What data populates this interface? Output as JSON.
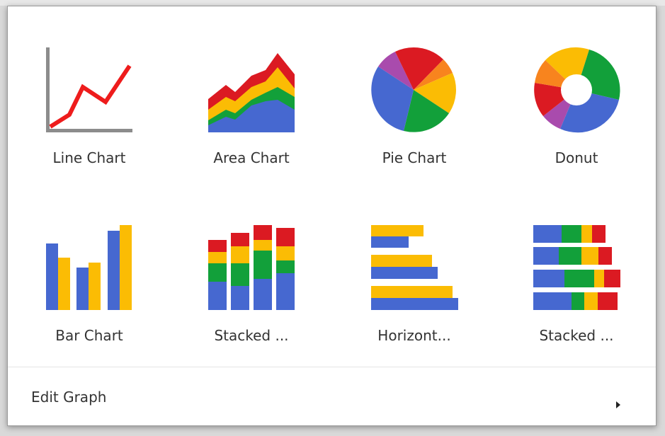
{
  "colors": {
    "blue": "#4668d0",
    "yellow": "#fbbc04",
    "green": "#12a03a",
    "red": "#db1a22",
    "orange": "#f8841e",
    "purple": "#a94bad",
    "axis": "#8c8c8c"
  },
  "chart_menu": {
    "items": [
      {
        "label": "Line Chart",
        "icon": "line-chart-icon"
      },
      {
        "label": "Area Chart",
        "icon": "area-chart-icon"
      },
      {
        "label": "Pie Chart",
        "icon": "pie-chart-icon"
      },
      {
        "label": "Donut",
        "icon": "donut-chart-icon"
      },
      {
        "label": "Bar Chart",
        "icon": "bar-chart-icon"
      },
      {
        "label": "Stacked ...",
        "icon": "stacked-bar-chart-icon"
      },
      {
        "label": "Horizont...",
        "icon": "horizontal-bar-chart-icon"
      },
      {
        "label": "Stacked ...",
        "icon": "stacked-horizontal-bar-chart-icon"
      }
    ]
  },
  "footer": {
    "edit_label": "Edit Graph",
    "submenu_icon": "caret-right-icon"
  }
}
